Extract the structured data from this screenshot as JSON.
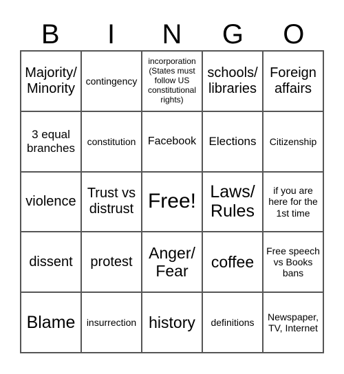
{
  "header": [
    "B",
    "I",
    "N",
    "G",
    "O"
  ],
  "cells": [
    [
      "Majority/ Minority",
      "contingency",
      "incorporation (States must follow US constitutional rights)",
      "schools/ libraries",
      "Foreign affairs"
    ],
    [
      "3 equal branches",
      "constitution",
      "Facebook",
      "Elections",
      "Citizenship"
    ],
    [
      "violence",
      "Trust vs distrust",
      "Free!",
      "Laws/ Rules",
      "if you are here for the 1st time"
    ],
    [
      "dissent",
      "protest",
      "Anger/ Fear",
      "coffee",
      "Free speech vs Books bans"
    ],
    [
      "Blame",
      "insurrection",
      "history",
      "definitions",
      "Newspaper, TV, Internet"
    ]
  ]
}
